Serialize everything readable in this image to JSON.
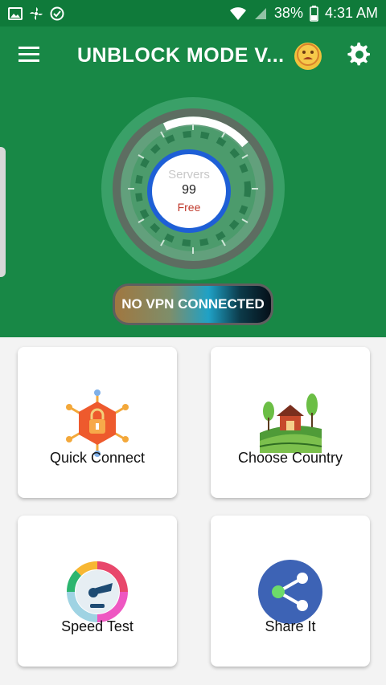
{
  "status_bar": {
    "battery": "38%",
    "time": "4:31 AM"
  },
  "header": {
    "title": "UNBLOCK MODE V..."
  },
  "gauge": {
    "label": "Servers",
    "count": "99",
    "status": "Free"
  },
  "vpn_button": {
    "label": "NO VPN CONNECTED"
  },
  "cards": [
    {
      "label": "Quick Connect"
    },
    {
      "label": "Choose Country"
    },
    {
      "label": "Speed Test"
    },
    {
      "label": "Share It"
    }
  ],
  "icons": {
    "status_left": [
      "image-icon",
      "fan-icon",
      "check-circle-icon"
    ],
    "status_right": [
      "wifi-icon",
      "signal-icon",
      "battery-icon"
    ],
    "header": [
      "menu-icon",
      "emoji-icon",
      "settings-icon"
    ],
    "cards": [
      "hexagon-lock-icon",
      "farm-house-icon",
      "speedometer-icon",
      "share-icon"
    ]
  },
  "colors": {
    "brand_green": "#188846",
    "status_green": "#0f7a3a",
    "gauge_ring_blue": "#1e5fd6",
    "free_red": "#c0392b"
  }
}
